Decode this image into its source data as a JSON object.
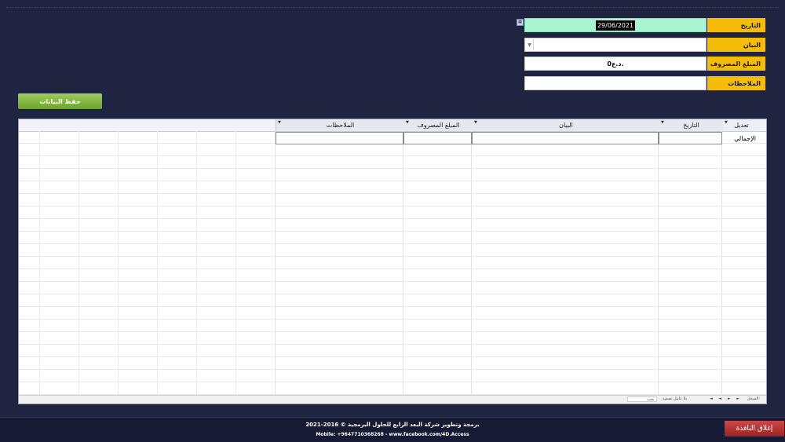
{
  "form": {
    "date_label": "التاريخ",
    "date_value": "29/06/2021",
    "description_label": "البيان",
    "description_value": "",
    "amount_label": "المبلغ المصروف",
    "amount_value": "0د.ع.",
    "notes_label": "الملاحظات",
    "notes_value": ""
  },
  "save_button_label": "حفظ البيانات",
  "table": {
    "columns": [
      "تعديل",
      "التاريخ",
      "البيان",
      "المبلغ المصروف",
      "الملاحظات"
    ],
    "total_label": "الإجمالي",
    "nav": {
      "record_label": "السجل:",
      "no_filter_label": "بلا عامل تصفية",
      "search_label": "بحث"
    }
  },
  "footer": {
    "line1": "برمجة وتطوير شركة البعد الرابع للحلول البرمجية © 2016-2021",
    "line2": "Mobile: +9647710368268 - www.facebook.com/4D.Access"
  },
  "close_button_label": "إغلاق النافذة",
  "colors": {
    "background": "#1f2540",
    "label_bg": "#f5bd0a",
    "date_bg": "#a9f5d1",
    "save_button": "#7db43c",
    "close_button": "#b33434"
  }
}
